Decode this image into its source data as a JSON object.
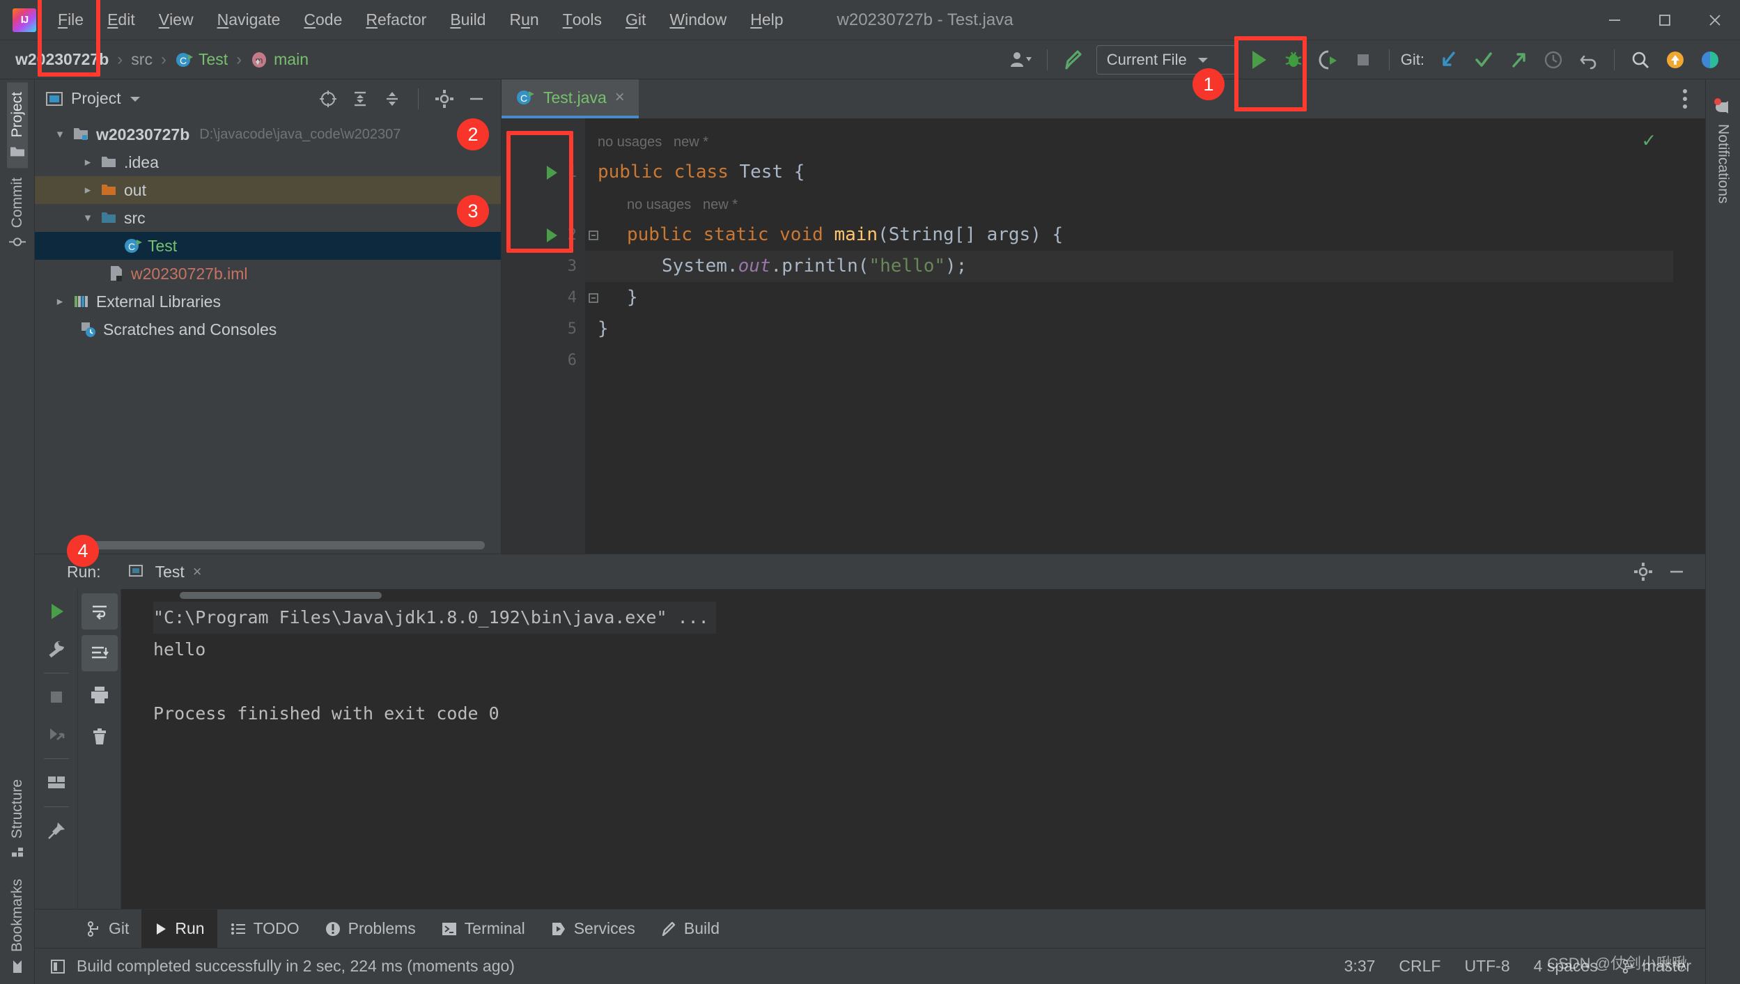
{
  "window": {
    "title": "w20230727b - Test.java",
    "minimize_label": "Minimize",
    "maximize_label": "Maximize",
    "close_label": "Close"
  },
  "menu": [
    {
      "pre": "",
      "key": "F",
      "post": "ile"
    },
    {
      "pre": "",
      "key": "E",
      "post": "dit"
    },
    {
      "pre": "",
      "key": "V",
      "post": "iew"
    },
    {
      "pre": "",
      "key": "N",
      "post": "avigate"
    },
    {
      "pre": "",
      "key": "C",
      "post": "ode"
    },
    {
      "pre": "",
      "key": "R",
      "post": "efactor"
    },
    {
      "pre": "",
      "key": "B",
      "post": "uild"
    },
    {
      "pre": "R",
      "key": "u",
      "post": "n"
    },
    {
      "pre": "",
      "key": "T",
      "post": "ools"
    },
    {
      "pre": "",
      "key": "G",
      "post": "it"
    },
    {
      "pre": "",
      "key": "W",
      "post": "indow"
    },
    {
      "pre": "",
      "key": "H",
      "post": "elp"
    }
  ],
  "breadcrumb": {
    "project": "w20230727b",
    "src": "src",
    "class": "Test",
    "method": "main",
    "sep": "›"
  },
  "toolbar": {
    "run_config": "Current File",
    "git_label": "Git:",
    "user_icon": "user-icon",
    "build_icon": "build-hammer-icon",
    "run_icon": "run-icon",
    "debug_icon": "debug-icon",
    "coverage_icon": "run-with-coverage-icon",
    "stop_icon": "stop-icon",
    "update_icon": "git-update-icon",
    "commit_icon": "git-commit-icon",
    "push_icon": "git-push-icon",
    "history_icon": "history-icon",
    "rollback_icon": "rollback-icon",
    "search_icon": "search-everywhere-icon",
    "updates_icon": "ide-update-icon",
    "feedback_icon": "feedback-icon"
  },
  "left_stripe": [
    {
      "label": "Project",
      "icon": "project-folder-icon",
      "active": true
    },
    {
      "label": "Commit",
      "icon": "commit-icon",
      "active": false
    },
    {
      "label": "Structure",
      "icon": "structure-icon",
      "active": false
    },
    {
      "label": "Bookmarks",
      "icon": "bookmark-icon",
      "active": false
    }
  ],
  "right_stripe": [
    {
      "label": "Notifications",
      "icon": "notifications-bell-icon"
    }
  ],
  "project_panel": {
    "title": "Project",
    "dropdown_icon": "chevron-down-icon",
    "icons": [
      "locate-icon",
      "expand-all-icon",
      "collapse-all-icon",
      "settings-gear-icon",
      "hide-icon"
    ],
    "tree": [
      {
        "label": "w20230727b",
        "path": "D:\\javacode\\java_code\\w202307",
        "indent": 0,
        "arrow": "down",
        "icon": "module-folder-icon",
        "style": "root"
      },
      {
        "label": ".idea",
        "path": "",
        "indent": 1,
        "arrow": "right",
        "icon": "folder-icon",
        "style": "normal"
      },
      {
        "label": "out",
        "path": "",
        "indent": 1,
        "arrow": "right",
        "icon": "folder-orange-icon",
        "style": "excluded"
      },
      {
        "label": "src",
        "path": "",
        "indent": 1,
        "arrow": "down",
        "icon": "folder-source-icon",
        "style": "normal"
      },
      {
        "label": "Test",
        "path": "",
        "indent": 2,
        "arrow": "none",
        "icon": "java-class-runnable-icon",
        "style": "selected"
      },
      {
        "label": "w20230727b.iml",
        "path": "",
        "indent": 1,
        "arrow": "none",
        "icon": "iml-file-icon",
        "style": "iml"
      },
      {
        "label": "External Libraries",
        "path": "",
        "indent": 0,
        "arrow": "right",
        "icon": "libraries-icon",
        "style": "normal"
      },
      {
        "label": "Scratches and Consoles",
        "path": "",
        "indent": 0,
        "arrow": "none",
        "icon": "scratches-icon",
        "style": "normal"
      }
    ]
  },
  "editor": {
    "tab": {
      "label": "Test.java",
      "icon": "java-class-runnable-icon",
      "close": "×"
    },
    "inspection_status": "ok",
    "lines": [
      {
        "num": "",
        "type": "hint",
        "text": "no usages   new *",
        "indent": 0,
        "gutter_run": false,
        "current": false
      },
      {
        "num": "1",
        "type": "code",
        "indent": 0,
        "gutter_run": true,
        "current": false,
        "tokens": [
          {
            "t": "public ",
            "c": "kw"
          },
          {
            "t": "class ",
            "c": "kw"
          },
          {
            "t": "Test",
            "c": "pl"
          },
          {
            "t": " {",
            "c": "pl"
          }
        ]
      },
      {
        "num": "",
        "type": "hint",
        "text": "no usages   new *",
        "indent": 1,
        "gutter_run": false,
        "current": false
      },
      {
        "num": "2",
        "type": "code",
        "indent": 1,
        "gutter_run": true,
        "current": false,
        "fold": true,
        "tokens": [
          {
            "t": "public ",
            "c": "kw"
          },
          {
            "t": "static ",
            "c": "kw"
          },
          {
            "t": "void ",
            "c": "kw"
          },
          {
            "t": "main",
            "c": "fn"
          },
          {
            "t": "(String[] args) {",
            "c": "pl"
          }
        ]
      },
      {
        "num": "3",
        "type": "code",
        "indent": 2,
        "gutter_run": false,
        "current": true,
        "tokens": [
          {
            "t": "System.",
            "c": "pl"
          },
          {
            "t": "out",
            "c": "fld"
          },
          {
            "t": ".println(",
            "c": "pl"
          },
          {
            "t": "\"hello\"",
            "c": "str"
          },
          {
            "t": ");",
            "c": "pl"
          }
        ]
      },
      {
        "num": "4",
        "type": "code",
        "indent": 1,
        "gutter_run": false,
        "current": false,
        "fold": true,
        "tokens": [
          {
            "t": "}",
            "c": "pl"
          }
        ]
      },
      {
        "num": "5",
        "type": "code",
        "indent": 0,
        "gutter_run": false,
        "current": false,
        "tokens": [
          {
            "t": "}",
            "c": "pl"
          }
        ]
      },
      {
        "num": "6",
        "type": "code",
        "indent": 0,
        "gutter_run": false,
        "current": false,
        "tokens": []
      }
    ]
  },
  "run_panel": {
    "label": "Run:",
    "tab": {
      "label": "Test",
      "icon": "run-config-icon",
      "close": "×"
    },
    "head_icons": [
      "settings-gear-icon",
      "hide-icon"
    ],
    "tools_col1": [
      "rerun-icon",
      "edit-configuration-wrench-icon",
      "stop-icon",
      "rerun-failed-icon",
      "layout-settings-icon",
      "pin-tab-icon"
    ],
    "tools_col2": [
      "soft-wrap-icon",
      "scroll-to-end-icon",
      "print-icon",
      "clear-all-trash-icon"
    ],
    "console": [
      {
        "text": "\"C:\\Program Files\\Java\\jdk1.8.0_192\\bin\\java.exe\" ...",
        "style": "cmd"
      },
      {
        "text": "hello",
        "style": "out"
      },
      {
        "text": "",
        "style": "out"
      },
      {
        "text": "Process finished with exit code 0",
        "style": "out"
      }
    ]
  },
  "tool_windows": [
    {
      "label": "Git",
      "icon": "git-branch-icon",
      "active": false
    },
    {
      "label": "Run",
      "icon": "run-icon",
      "active": true
    },
    {
      "label": "TODO",
      "icon": "todo-list-icon",
      "active": false
    },
    {
      "label": "Problems",
      "icon": "problems-icon",
      "active": false
    },
    {
      "label": "Terminal",
      "icon": "terminal-icon",
      "active": false
    },
    {
      "label": "Services",
      "icon": "services-icon",
      "active": false
    },
    {
      "label": "Build",
      "icon": "build-hammer-icon",
      "active": false
    }
  ],
  "status_bar": {
    "icon": "event-log-icon",
    "message": "Build completed successfully in 2 sec, 224 ms (moments ago)",
    "caret": "3:37",
    "line_separator": "CRLF",
    "encoding": "UTF-8",
    "indent": "4 spaces",
    "branch_icon": "git-branch-icon",
    "branch": "master",
    "watermark": "CSDN @仗剑小啾啾"
  },
  "annotations": [
    {
      "id": "1",
      "target": "toolbar-run-button"
    },
    {
      "id": "2",
      "target": "editor-gutter-run-markers"
    },
    {
      "id": "3",
      "target": "editor-gutter-run-markers"
    },
    {
      "id": "4",
      "target": "run-panel-rerun-button"
    }
  ],
  "colors": {
    "accent_green": "#59a869",
    "annotation_red": "#f8352b",
    "tab_underline": "#4a88c7",
    "selection": "#0d293e"
  }
}
